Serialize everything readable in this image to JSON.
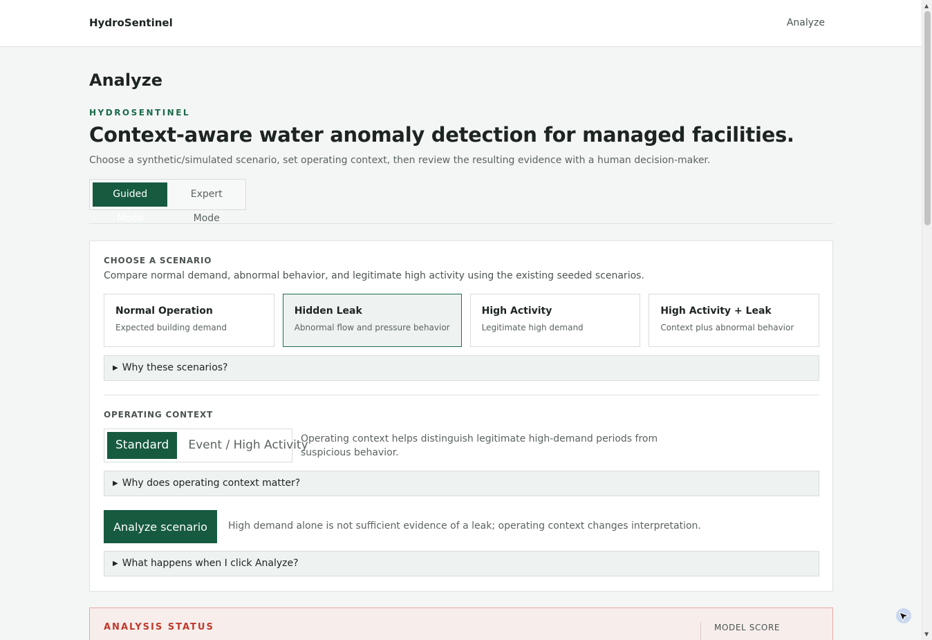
{
  "nav": {
    "brand": "HydroSentinel",
    "link": "Analyze"
  },
  "page": {
    "title": "Analyze",
    "eyebrow": "HYDROSENTINEL",
    "headline": "Context-aware water anomaly detection for managed facilities.",
    "lede": "Choose a synthetic/simulated scenario, set operating context, then review the resulting evidence with a human decision-maker."
  },
  "mode": {
    "options": [
      "Guided Mode",
      "Expert Mode"
    ],
    "selected": "Guided Mode"
  },
  "scenario_section": {
    "label": "CHOOSE A SCENARIO",
    "description": "Compare normal demand, abnormal behavior, and legitimate high activity using the existing seeded scenarios.",
    "options": [
      {
        "title": "Normal Operation",
        "subtitle": "Expected building demand"
      },
      {
        "title": "Hidden Leak",
        "subtitle": "Abnormal flow and pressure behavior"
      },
      {
        "title": "High Activity",
        "subtitle": "Legitimate high demand"
      },
      {
        "title": "High Activity + Leak",
        "subtitle": "Context plus abnormal behavior"
      }
    ],
    "selected": "Hidden Leak",
    "disclosure": "Why these scenarios?"
  },
  "context_section": {
    "label": "OPERATING CONTEXT",
    "options": [
      "Standard",
      "Event / High Activity"
    ],
    "selected": "Standard",
    "note": "Operating context helps distinguish legitimate high-demand periods from suspicious behavior.",
    "disclosure": "Why does operating context matter?"
  },
  "analyze": {
    "button": "Analyze scenario",
    "note": "High demand alone is not sufficient evidence of a leak; operating context changes interpretation.",
    "disclosure": "What happens when I click Analyze?"
  },
  "status": {
    "label": "ANALYSIS STATUS",
    "score_label": "MODEL SCORE"
  },
  "icons": {
    "disclosure": "triangle-right-icon",
    "cursor": "pointer-cursor-icon"
  },
  "colors": {
    "accent": "#165a40",
    "eyebrow": "#1a6b4a",
    "alert": "#c0392b",
    "alert_bg": "#f7eeec"
  }
}
